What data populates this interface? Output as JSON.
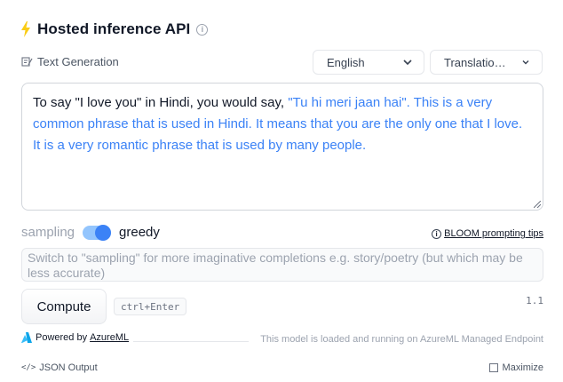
{
  "header": {
    "title": "Hosted inference API",
    "bolt_icon": "lightning-icon",
    "info_icon": "info-icon"
  },
  "task": {
    "label": "Text Generation",
    "icon": "text-generation-icon"
  },
  "selects": {
    "language": "English",
    "task": "Translatio…"
  },
  "textbox": {
    "input": "To say \"I love you\" in Hindi, you would say, ",
    "output": "\"Tu hi meri jaan hai\". This is a very common phrase that is used in Hindi. It means that you are the only one that I love. It is a very romantic phrase that is used by many people."
  },
  "mode": {
    "left": "sampling",
    "right": "greedy",
    "selected": "greedy"
  },
  "tips": {
    "link": "BLOOM prompting tips"
  },
  "hint": "Switch to \"sampling\" for more imaginative completions e.g. story/poetry (but which may be less accurate)",
  "compute": {
    "label": "Compute",
    "shortcut": "ctrl+Enter",
    "timing": "1.1"
  },
  "footer": {
    "powered_by": "Powered by",
    "provider": "AzureML",
    "endpoint_note": "This model is loaded and running on AzureML Managed Endpoint",
    "json_output": "JSON Output",
    "maximize": "Maximize"
  },
  "colors": {
    "accent": "#3b82f6",
    "bolt": "#facc15",
    "toggle_track": "#93c5fd"
  }
}
